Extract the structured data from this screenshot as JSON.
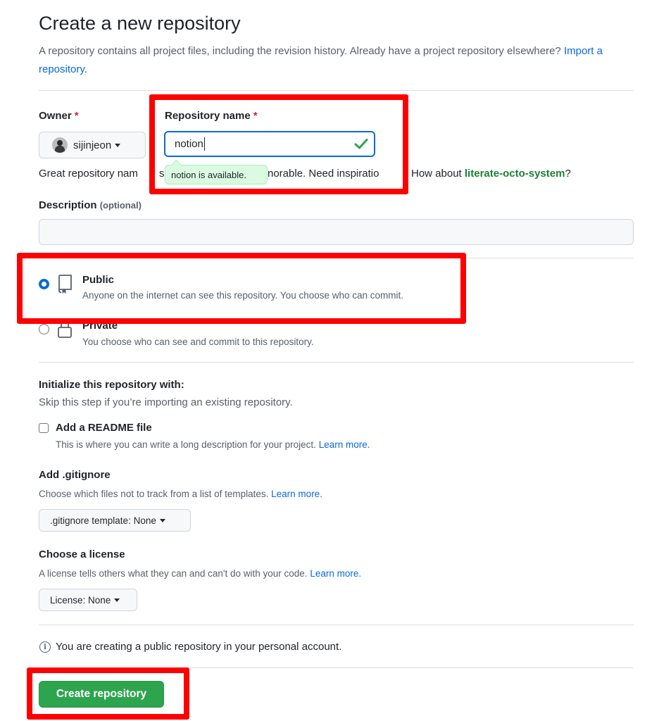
{
  "page": {
    "title": "Create a new repository",
    "subtitle_text": "A repository contains all project files, including the revision history. Already have a project repository elsewhere?",
    "import_link": "Import a repository."
  },
  "owner": {
    "label": "Owner",
    "required_mark": "*",
    "username": "sijinjeon",
    "avatar_icon": "user-avatar"
  },
  "repo_name": {
    "label": "Repository name",
    "required_mark": "*",
    "value": "notion",
    "valid_icon": "check-icon",
    "availability_tooltip": "notion is available."
  },
  "name_hint": {
    "before_tooltip": "Great repository nam",
    "middle": "s",
    "after_tooltip": "norable. Need inspiratio",
    "after_box": "How about",
    "suggestion": "literate-octo-system",
    "end": "?"
  },
  "description": {
    "label": "Description",
    "optional": "(optional)",
    "value": ""
  },
  "visibility": {
    "public": {
      "label": "Public",
      "description": "Anyone on the internet can see this repository. You choose who can commit.",
      "selected": true,
      "icon": "repo-icon"
    },
    "private": {
      "label": "Private",
      "description": "You choose who can see and commit to this repository.",
      "selected": false,
      "icon": "lock-icon"
    }
  },
  "initialize": {
    "heading": "Initialize this repository with:",
    "subtext": "Skip this step if you’re importing an existing repository.",
    "readme_label": "Add a README file",
    "readme_desc": "This is where you can write a long description for your project.",
    "readme_link": "Learn more.",
    "readme_checked": false
  },
  "gitignore": {
    "heading": "Add .gitignore",
    "desc": "Choose which files not to track from a list of templates.",
    "link": "Learn more.",
    "select_label": ".gitignore template: None"
  },
  "license": {
    "heading": "Choose a license",
    "desc": "A license tells others what they can and can't do with your code.",
    "link": "Learn more.",
    "select_label": "License: None"
  },
  "notice": {
    "icon": "info-icon",
    "icon_glyph": "i",
    "text": "You are creating a public repository in your personal account."
  },
  "submit": {
    "label": "Create repository"
  },
  "colors": {
    "highlight_box": "#ff0000",
    "primary_button": "#2da44e",
    "link": "#0969da",
    "suggestion": "#1a7f37"
  }
}
